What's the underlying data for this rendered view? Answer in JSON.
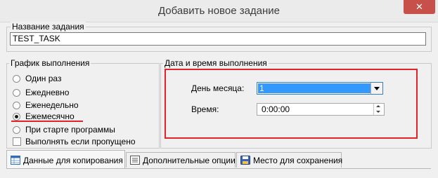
{
  "window": {
    "title": "Добавить новое задание",
    "close_symbol": "✕"
  },
  "task_name": {
    "legend": "Название задания",
    "value": "TEST_TASK"
  },
  "schedule": {
    "legend": "График выполнения",
    "options": [
      {
        "label": "Один раз",
        "checked": false
      },
      {
        "label": "Ежедневно",
        "checked": false
      },
      {
        "label": "Еженедельно",
        "checked": false
      },
      {
        "label": "Ежемесячно",
        "checked": true
      },
      {
        "label": "При старте программы",
        "checked": false
      }
    ],
    "run_if_missed": {
      "label": "Выполнять если пропущено",
      "checked": false
    }
  },
  "datetime": {
    "legend": "Дата и время выполнения",
    "day_label": "День месяца:",
    "day_value": "1",
    "time_label": "Время:",
    "time_value": "0:00:00"
  },
  "tabs": [
    {
      "label": "Данные для копирования",
      "icon": "table-icon",
      "active": true
    },
    {
      "label": "Дополнительные опции",
      "icon": "options-icon",
      "active": false
    },
    {
      "label": "Место для сохранения",
      "icon": "save-location-icon",
      "active": false
    }
  ],
  "colors": {
    "highlight": "#e1242a",
    "selection": "#3399ff",
    "close_button": "#c7504b"
  }
}
